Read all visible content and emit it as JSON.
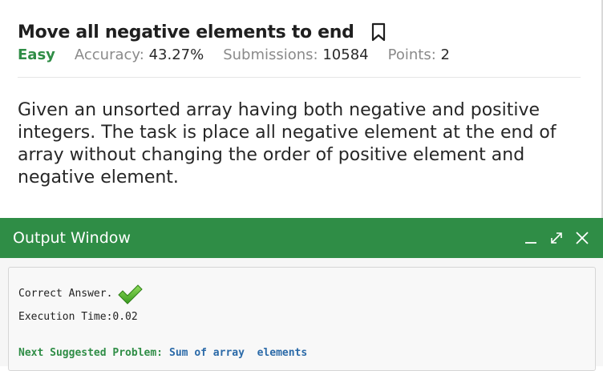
{
  "problem": {
    "title": "Move all negative elements to end",
    "difficulty": "Easy",
    "accuracy_label": "Accuracy:",
    "accuracy_value": "43.27%",
    "submissions_label": "Submissions:",
    "submissions_value": "10584",
    "points_label": "Points:",
    "points_value": "2",
    "description": "Given an unsorted array having both negative and positive integers. The task is place all negative element at the end of array without changing the order of positive element and negative element."
  },
  "output_window": {
    "title": "Output Window",
    "result": "Correct Answer.",
    "execution_time": "Execution Time:0.02",
    "next_label": "Next Suggested Problem:",
    "next_problem": "Sum of array  elements"
  },
  "colors": {
    "brand_green": "#2f8d46",
    "link_blue": "#2b6aa8"
  },
  "icons": [
    "bookmark-icon",
    "minimize-icon",
    "maximize-icon",
    "close-icon",
    "checkmark-icon"
  ]
}
